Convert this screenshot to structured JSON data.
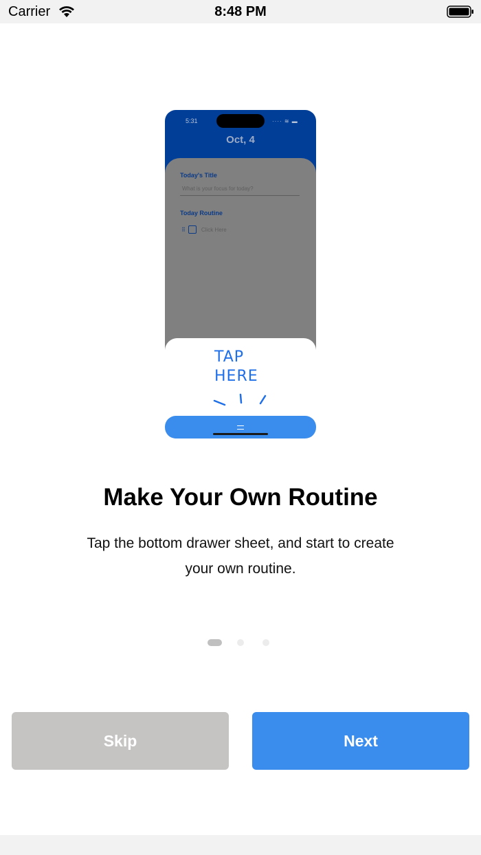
{
  "status_bar": {
    "carrier": "Carrier",
    "time": "8:48 PM",
    "icons": [
      "wifi-icon",
      "battery-icon"
    ]
  },
  "illustration": {
    "phone_time": "5:31",
    "phone_date": "Oct, 4",
    "todays_title_label": "Today's Title",
    "todays_title_placeholder": "What is your focus for today?",
    "routine_label": "Today Routine",
    "routine_item_placeholder": "Click Here",
    "tap_note_line1": "TAP",
    "tap_note_line2": "HERE",
    "colors": {
      "header": "#003e97",
      "accent": "#3a8ded",
      "note": "#1f6fe8"
    }
  },
  "onboarding": {
    "title": "Make Your Own Routine",
    "description": "Tap the bottom drawer sheet, and start to create your own routine.",
    "page_count": 3,
    "current_page": 1
  },
  "buttons": {
    "skip_label": "Skip",
    "next_label": "Next",
    "colors": {
      "skip": "#c6c4c3",
      "next": "#3a8ded"
    }
  }
}
